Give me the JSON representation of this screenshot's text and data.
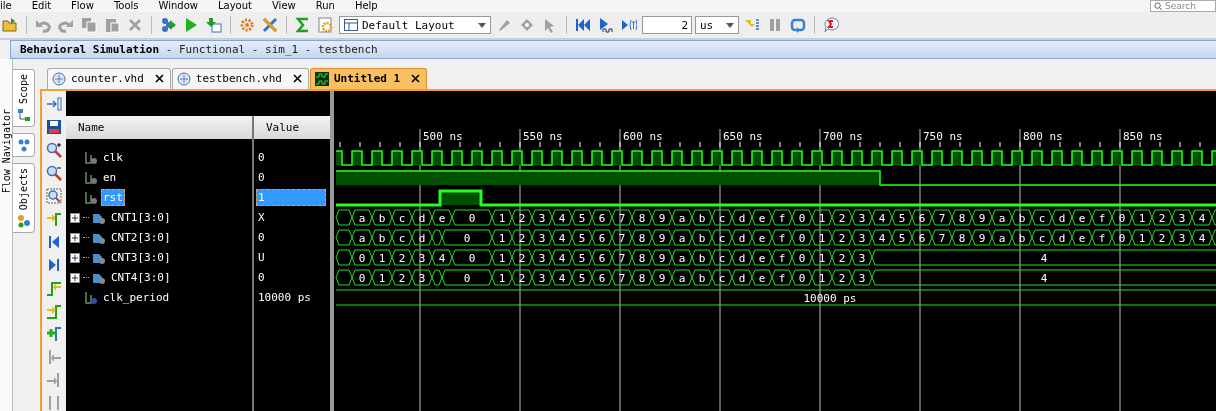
{
  "menu": {
    "items": [
      "ile",
      "Edit",
      "Flow",
      "Tools",
      "Window",
      "Layout",
      "View",
      "Run",
      "Help"
    ]
  },
  "search": {
    "placeholder": "Search"
  },
  "toolbar": {
    "left_buttons": [
      {
        "disabled": false
      },
      {
        "disabled": true
      },
      {
        "disabled": true
      },
      {
        "disabled": true
      },
      {
        "disabled": true
      },
      {
        "disabled": true
      },
      {
        "disabled": false
      },
      {
        "disabled": false
      },
      {
        "disabled": false
      },
      {
        "disabled": false
      },
      {
        "disabled": false
      },
      {
        "disabled": false
      },
      {
        "disabled": false
      }
    ],
    "layout_dropdown": {
      "value": "Default Layout"
    },
    "mid_buttons": [
      {
        "disabled": true
      },
      {
        "disabled": true
      },
      {
        "disabled": true
      },
      {
        "disabled": false
      },
      {
        "disabled": false
      },
      {
        "disabled": false
      }
    ],
    "time_field": {
      "value": "2"
    },
    "unit_dropdown": {
      "value": "us"
    },
    "right_buttons": [
      {
        "disabled": false
      },
      {
        "disabled": true
      },
      {
        "disabled": false
      },
      {
        "disabled": false
      }
    ]
  },
  "title_bar": {
    "title": "**Behavioral Simulation** - Functional - sim_1 - testbench"
  },
  "flow_navigator": {
    "label": "Flow Navigator"
  },
  "side_tabs": [
    {
      "label": "Scope"
    },
    {
      "label": "Objects"
    }
  ],
  "editor_tabs": [
    {
      "label": "counter.vhd",
      "kind": "vhdl",
      "selected": false
    },
    {
      "label": "testbench.vhd",
      "kind": "vhdl",
      "selected": false
    },
    {
      "label": "Untitled 1",
      "kind": "wave",
      "selected": true
    }
  ],
  "wave_tools": [
    {
      "disabled": false
    },
    {
      "disabled": false
    },
    {
      "disabled": false
    },
    {
      "disabled": false
    },
    {
      "disabled": false
    },
    {
      "disabled": false
    },
    {
      "disabled": false
    },
    {
      "disabled": false
    },
    {
      "disabled": false
    },
    {
      "disabled": false
    },
    {
      "disabled": false
    },
    {
      "disabled": true
    },
    {
      "disabled": true
    },
    {
      "disabled": true
    }
  ],
  "columns": [
    "Name",
    "Value"
  ],
  "time_axis": {
    "labels": [
      "500 ns",
      "550 ns",
      "600 ns",
      "650 ns",
      "700 ns",
      "750 ns",
      "800 ns",
      "850 ns"
    ]
  },
  "signals": [
    {
      "name": "clk",
      "value": "0",
      "kind": "bit",
      "selected": false
    },
    {
      "name": "en",
      "value": "0",
      "kind": "bit",
      "selected": false
    },
    {
      "name": "rst",
      "value": "1",
      "kind": "bit",
      "selected": true
    },
    {
      "name": "CNT1[3:0]",
      "value": "X",
      "kind": "bus",
      "selected": false,
      "wave": [
        "a",
        "b",
        "c",
        "d",
        "e",
        "0",
        "1",
        "2",
        "3",
        "4",
        "5",
        "6",
        "7",
        "8",
        "9",
        "a",
        "b",
        "c",
        "d",
        "e",
        "f",
        "0",
        "1",
        "2",
        "3",
        "4",
        "5",
        "6",
        "7",
        "8",
        "9",
        "a",
        "b",
        "c",
        "d",
        "e",
        "f",
        "0",
        "1",
        "2",
        "3",
        "4"
      ]
    },
    {
      "name": "CNT2[3:0]",
      "value": "0",
      "kind": "bus",
      "selected": false,
      "wave": [
        "a",
        "b",
        "c",
        "d",
        "0",
        "1",
        "2",
        "3",
        "4",
        "5",
        "6",
        "7",
        "8",
        "9",
        "a",
        "b",
        "c",
        "d",
        "e",
        "f",
        "0",
        "1",
        "2",
        "3",
        "4",
        "5",
        "6",
        "7",
        "8",
        "9",
        "a",
        "b",
        "c",
        "d",
        "e",
        "f",
        "0",
        "1",
        "2",
        "3",
        "4"
      ]
    },
    {
      "name": "CNT3[3:0]",
      "value": "U",
      "kind": "bus",
      "selected": false,
      "wave": [
        "0",
        "1",
        "2",
        "3",
        "4",
        "0",
        "1",
        "2",
        "3",
        "4",
        "5",
        "6",
        "7",
        "8",
        "9",
        "a",
        "b",
        "c",
        "d",
        "e",
        "f",
        "0",
        "1",
        "2",
        "3",
        "4"
      ]
    },
    {
      "name": "CNT4[3:0]",
      "value": "0",
      "kind": "bus",
      "selected": false,
      "wave": [
        "0",
        "1",
        "2",
        "3",
        "0",
        "1",
        "2",
        "3",
        "4",
        "5",
        "6",
        "7",
        "8",
        "9",
        "a",
        "b",
        "c",
        "d",
        "e",
        "f",
        "0",
        "1",
        "2",
        "3",
        "4"
      ]
    },
    {
      "name": "clk_period",
      "value": "10000 ps",
      "kind": "const",
      "selected": false,
      "wave": [
        "10000 ps"
      ]
    }
  ]
}
